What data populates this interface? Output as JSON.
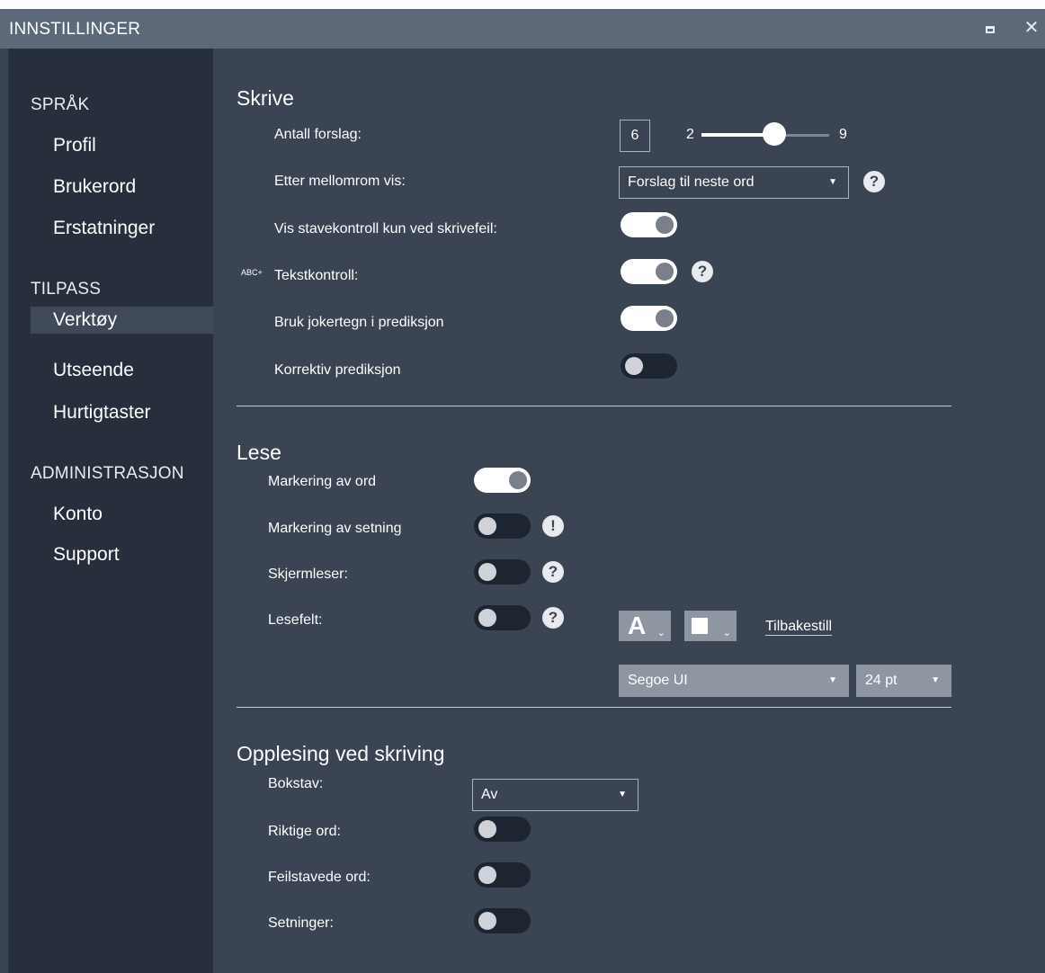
{
  "window": {
    "title": "INNSTILLINGER",
    "maximize_icon": "maximize-icon",
    "close_glyph": "✕"
  },
  "sidebar": {
    "sections": [
      {
        "title": "SPRÅK",
        "items": [
          "Profil",
          "Brukerord",
          "Erstatninger"
        ]
      },
      {
        "title": "TILPASS",
        "items": [
          "Verktøy",
          "Utseende",
          "Hurtigtaster"
        ]
      },
      {
        "title": "ADMINISTRASJON",
        "items": [
          "Konto",
          "Support"
        ]
      }
    ],
    "active_item": "Verktøy"
  },
  "skrive": {
    "heading": "Skrive",
    "antall_label": "Antall forslag:",
    "antall_value": "6",
    "slider_min": "2",
    "slider_max": "9",
    "slider_value": 6,
    "etter_label": "Etter mellomrom vis:",
    "etter_value": "Forslag til neste ord",
    "stave_label": "Vis stavekontroll kun ved skrivefeil:",
    "stave_on": true,
    "tekst_label": "Tekstkontroll:",
    "tekst_icon_text": "ABC+",
    "tekst_on": true,
    "joker_label": "Bruk jokertegn i prediksjon",
    "joker_on": true,
    "korrektiv_label": "Korrektiv prediksjon",
    "korrektiv_on": false
  },
  "lese": {
    "heading": "Lese",
    "ord_label": "Markering av ord",
    "ord_on": true,
    "setning_label": "Markering av setning",
    "setning_on": false,
    "skjerm_label": "Skjermleser:",
    "skjerm_on": false,
    "felt_label": "Lesefelt:",
    "felt_on": false,
    "font_letter": "A",
    "reset_label": "Tilbakestill",
    "font_value": "Segoe UI",
    "size_value": "24 pt"
  },
  "opplesing": {
    "heading": "Opplesing ved skriving",
    "bokstav_label": "Bokstav:",
    "bokstav_value": "Av",
    "riktige_label": "Riktige ord:",
    "riktige_on": false,
    "feil_label": "Feilstavede ord:",
    "feil_on": false,
    "setninger_label": "Setninger:",
    "setninger_on": false
  },
  "glyphs": {
    "help": "?",
    "warn": "!",
    "caret": "▼",
    "small_caret": "⌄"
  }
}
